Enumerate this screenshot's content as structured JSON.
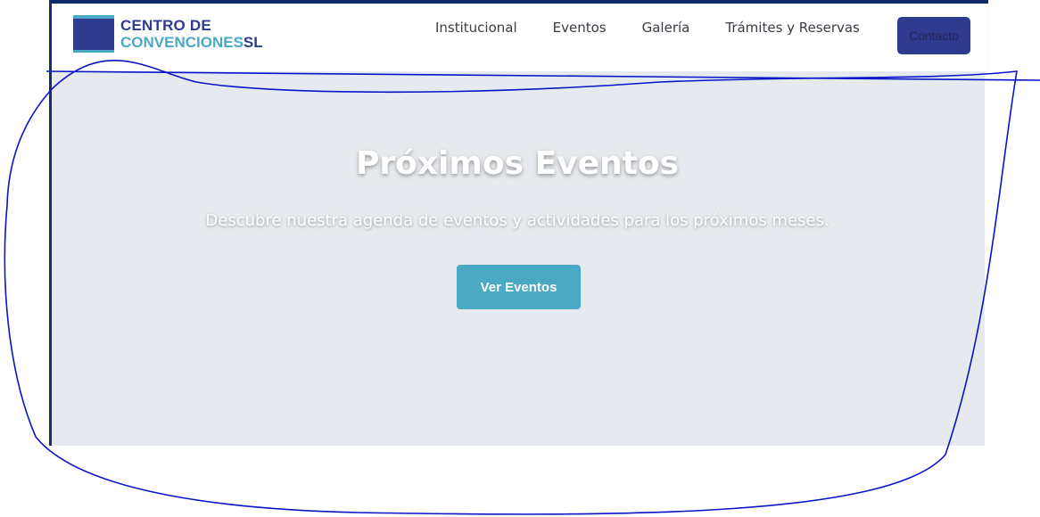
{
  "brand": {
    "line1": "CENTRO DE",
    "line2": "CONVENCIONES",
    "suffix": "SL"
  },
  "nav": {
    "links": [
      "Institucional",
      "Eventos",
      "Galería",
      "Trámites y Reservas"
    ],
    "contact_label": "Contacto"
  },
  "hero": {
    "title": "Próximos Eventos",
    "subtitle": "Descubre nuestra agenda de eventos y actividades para los próximos meses.",
    "button_label": "Ver Eventos"
  },
  "colors": {
    "brand_dark": "#2f3b8f",
    "brand_accent": "#4aa9c4",
    "hero_bg": "#e6e9ed",
    "annotation": "#0a14c8"
  }
}
